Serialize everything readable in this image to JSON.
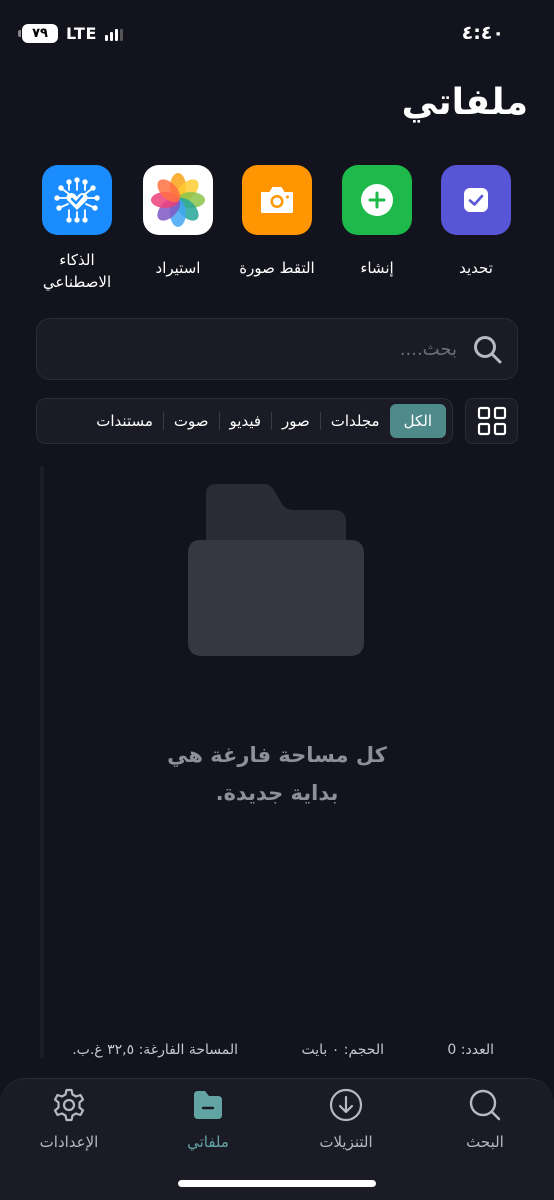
{
  "status": {
    "battery": "٧٩",
    "network": "LTE",
    "time": "٤:٤٠"
  },
  "page": {
    "title": "ملفاتي"
  },
  "actions": {
    "select": {
      "label": "تحديد",
      "icon": "checkbox-icon",
      "color": "#5856d6"
    },
    "create": {
      "label": "إنشاء",
      "icon": "plus-icon",
      "color": "#1db94a"
    },
    "photo": {
      "label": "التقط صورة",
      "icon": "camera-icon",
      "color": "#ff9500"
    },
    "import": {
      "label": "استيراد",
      "icon": "photos-icon",
      "color": "#ffffff"
    },
    "ai": {
      "label_line1": "الذكاء",
      "label_line2": "الاصطناعي",
      "icon": "ai-chip-icon",
      "color": "#1a8cff"
    }
  },
  "search": {
    "placeholder": "بحث....",
    "icon": "search-icon"
  },
  "filters": {
    "tabs": [
      "الكل",
      "مجلدات",
      "صور",
      "فيديو",
      "صوت",
      "مستندات"
    ],
    "active": "الكل",
    "accent": "#4f8a8b"
  },
  "empty": {
    "line1": "كل مساحة فارغة هي",
    "line2": "بداية جديدة."
  },
  "stats": {
    "count": "العدد: 0",
    "size": "الحجم: ٠ بايت",
    "free": "المساحة الفارغة: ٣٢,٥ غ.ب."
  },
  "nav": {
    "search": "البحث",
    "downloads": "التنزيلات",
    "files": "ملفاتي",
    "settings": "الإعدادات",
    "active": "ملفاتي",
    "active_color": "#62a3a4"
  }
}
